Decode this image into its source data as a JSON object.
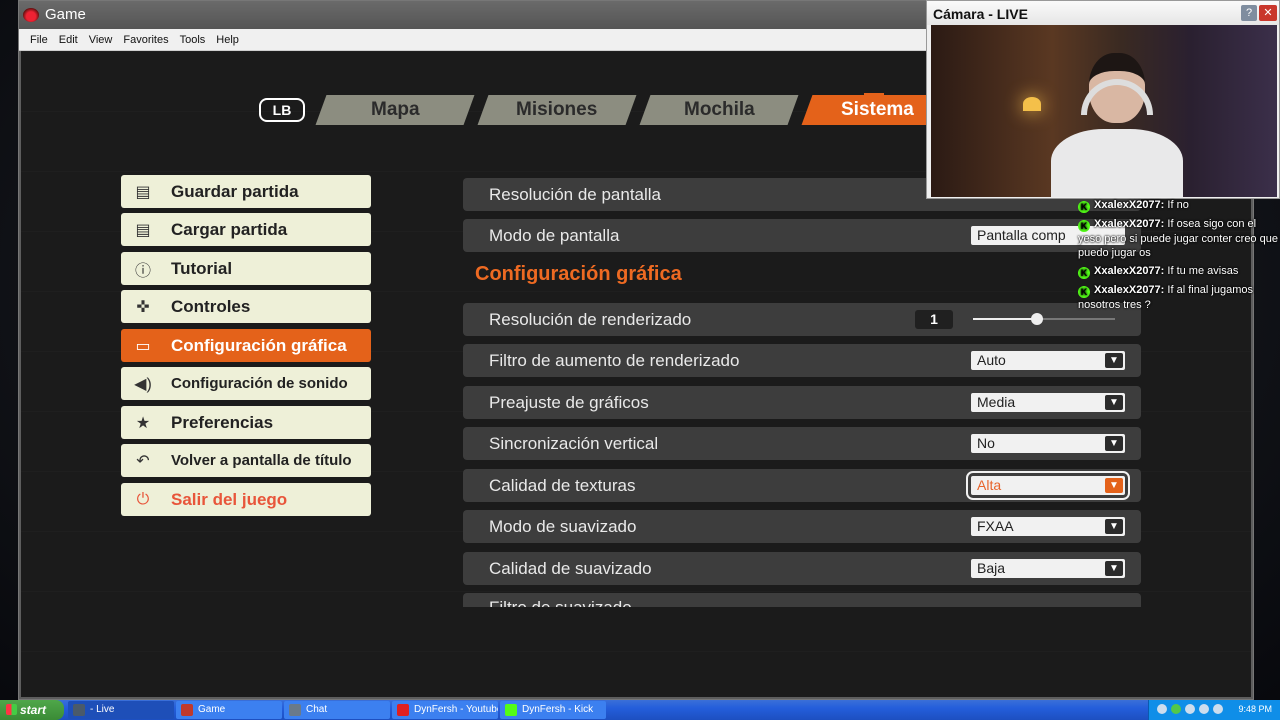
{
  "window": {
    "title": "Game",
    "menu": [
      "File",
      "Edit",
      "View",
      "Favorites",
      "Tools",
      "Help"
    ]
  },
  "tabs": {
    "lb": "LB",
    "items": [
      {
        "label": "Mapa",
        "active": false
      },
      {
        "label": "Misiones",
        "active": false
      },
      {
        "label": "Mochila",
        "active": false
      },
      {
        "label": "Sistema",
        "active": true
      }
    ]
  },
  "left_menu": [
    {
      "label": "Guardar partida",
      "icon": "notebook-icon"
    },
    {
      "label": "Cargar partida",
      "icon": "notebook-icon"
    },
    {
      "label": "Tutorial",
      "icon": "info-icon"
    },
    {
      "label": "Controles",
      "icon": "gamepad-icon"
    },
    {
      "label": "Configuración gráfica",
      "icon": "monitor-icon",
      "active": true
    },
    {
      "label": "Configuración de sonido",
      "icon": "speaker-icon"
    },
    {
      "label": "Preferencias",
      "icon": "star-icon"
    },
    {
      "label": "Volver a pantalla de título",
      "icon": "back-arrow-icon"
    },
    {
      "label": "Salir del juego",
      "icon": "power-icon"
    }
  ],
  "settings": {
    "section_title": "Configuración gráfica",
    "rows": [
      {
        "label": "Resolución de pantalla",
        "value": ""
      },
      {
        "label": "Modo de pantalla",
        "value": "Pantalla comp"
      },
      {
        "label": "Resolución de renderizado",
        "slider_value": "1",
        "slider_fraction": 0.45
      },
      {
        "label": "Filtro de aumento de renderizado",
        "value": "Auto"
      },
      {
        "label": "Preajuste de gráficos",
        "value": "Media"
      },
      {
        "label": "Sincronización vertical",
        "value": "No"
      },
      {
        "label": "Calidad de texturas",
        "value": "Alta",
        "selected": true
      },
      {
        "label": "Modo de suavizado",
        "value": "FXAA"
      },
      {
        "label": "Calidad de suavizado",
        "value": "Baja"
      },
      {
        "label": "Filtro de suavizado",
        "value": ""
      }
    ]
  },
  "camera": {
    "title": "Cámara - LIVE",
    "help": "?",
    "close": "✕"
  },
  "chat": [
    {
      "user": "XxalexX2077:",
      "text": "If no"
    },
    {
      "user": "XxalexX2077:",
      "text": "If osea sigo con el yeso pero si puede jugar conter creo que puedo jugar os"
    },
    {
      "user": "XxalexX2077:",
      "text": "If tu me avisas"
    },
    {
      "user": "XxalexX2077:",
      "text": "If al final jugamos nosotros tres ?"
    }
  ],
  "taskbar": {
    "start": "start",
    "buttons": [
      {
        "label": "- Live",
        "color": "#4a5a6a"
      },
      {
        "label": "Game",
        "color": "#c0392b"
      },
      {
        "label": "Chat",
        "color": "#6a7a8a"
      },
      {
        "label": "DynFersh - Youtube",
        "color": "#e02020"
      },
      {
        "label": "DynFersh - Kick",
        "color": "#53fc18"
      }
    ],
    "clock": "9:48 PM"
  },
  "colors": {
    "accent": "#e4621a",
    "menu_bg": "#eef0d8",
    "row_bg": "#3d3d3d",
    "exit": "#e8553a"
  }
}
